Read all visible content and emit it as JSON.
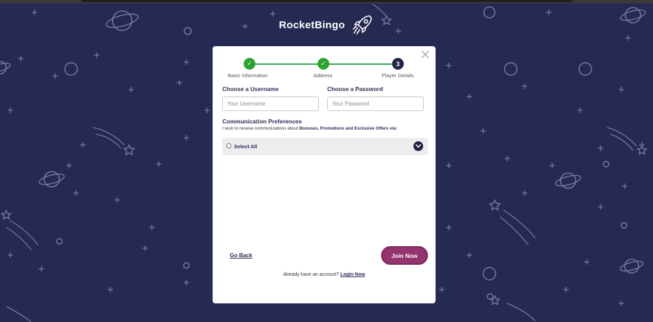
{
  "logo": {
    "text": "RocketBingo",
    "icon": "rocket-icon"
  },
  "colors": {
    "background": "#262952",
    "step_done": "#2ca32e",
    "step_current": "#23264a",
    "join_button": "#94336e",
    "heading": "#2a2d55"
  },
  "steps": [
    {
      "label": "Basic Information",
      "state": "done",
      "marker": "✓"
    },
    {
      "label": "Address",
      "state": "done",
      "marker": "✓"
    },
    {
      "label": "Player Details",
      "state": "current",
      "marker": "3"
    }
  ],
  "form": {
    "username": {
      "label": "Choose a Username",
      "placeholder": "Your Username",
      "value": ""
    },
    "password": {
      "label": "Choose a Password",
      "placeholder": "Your Password",
      "value": ""
    }
  },
  "communication": {
    "title": "Communication Preferences",
    "desc_prefix": "I wish to receive communications about ",
    "desc_bold": "Bonuses, Promotions and Exclusive Offers via:",
    "select_all_label": "Select All",
    "select_all_checked": false
  },
  "actions": {
    "go_back": "Go Back",
    "join_now": "Join Now",
    "already_text": "Already have an account? ",
    "login_link": "Login Now"
  }
}
